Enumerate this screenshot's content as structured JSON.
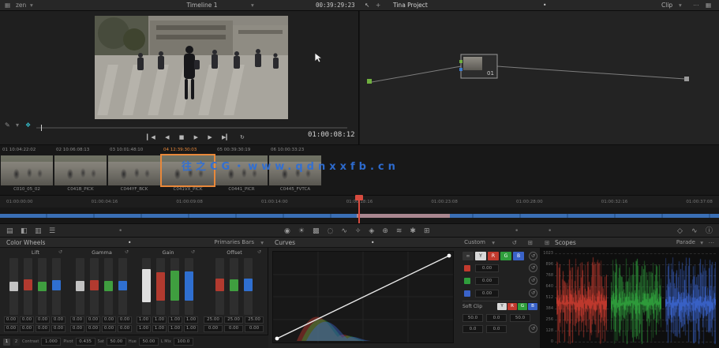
{
  "colors": {
    "accent_orange": "#e8883a",
    "playhead_red": "#d84b3f",
    "timeline_blue": "#3a6fb5",
    "watermark_blue": "#2e6fd6",
    "channel_red": "#c23a2e",
    "channel_green": "#2f9e3c",
    "channel_blue": "#3a63c9"
  },
  "topbar": {
    "left_menu": "zen",
    "timeline_selector": "Timeline 1",
    "timeline_timecode": "00:39:29:23",
    "window_title": "Tina Project",
    "clip_selector": "Clip"
  },
  "viewer": {
    "timecode": "01:00:08:12"
  },
  "node_graph": {
    "node_label": "01"
  },
  "clips": {
    "headers": [
      "01  10:04:22:02",
      "02  10:06:08:13",
      "03  10:01:48:10",
      "04  12:39:30:03",
      "05  00:39:30:19",
      "06  10:00:33:23"
    ],
    "names": [
      "C010_05_02",
      "C041B_PICK",
      "C044YF_BCK",
      "C041VX_PICK",
      "C0441_PICR",
      "C0445_FVTCA"
    ],
    "watermark": "往之CG・www.qdnxxfb.cn"
  },
  "timeline": {
    "ruler": [
      "01:00:00:00",
      "01:00:04:16",
      "01:00:09:08",
      "01:00:14:00",
      "01:00:18:16",
      "01:00:23:08",
      "01:00:28:00",
      "01:00:32:16",
      "01:00:37:08"
    ]
  },
  "wheels": {
    "title": "Color Wheels",
    "mode": "Primaries Bars",
    "columns": [
      {
        "name": "Lift",
        "row1": [
          "0.00",
          "0.00",
          "0.00",
          "0.00"
        ],
        "row2": [
          "0.00",
          "0.00",
          "0.00",
          "0.00"
        ]
      },
      {
        "name": "Gamma",
        "row1": [
          "0.00",
          "0.00",
          "0.00",
          "0.00"
        ],
        "row2": [
          "0.00",
          "0.00",
          "0.00",
          "0.00"
        ]
      },
      {
        "name": "Gain",
        "row1": [
          "1.00",
          "1.00",
          "1.00",
          "1.00"
        ],
        "row2": [
          "1.00",
          "1.00",
          "1.00",
          "1.00"
        ]
      },
      {
        "name": "Offset",
        "row1": [
          "25.00",
          "25.00",
          "25.00"
        ],
        "row2": [
          "0.00",
          "0.00",
          "0.00"
        ]
      }
    ],
    "pages": [
      "1",
      "2"
    ],
    "params": [
      {
        "label": "Contrast",
        "value": "1.000"
      },
      {
        "label": "Pivot",
        "value": "0.435"
      },
      {
        "label": "Sat",
        "value": "50.00"
      },
      {
        "label": "Hue",
        "value": "50.00"
      },
      {
        "label": "L Mix",
        "value": "100.0"
      }
    ]
  },
  "curves": {
    "title": "Curves",
    "mode": "Custom",
    "channels": [
      "Y",
      "R",
      "G",
      "B"
    ],
    "rows": [
      {
        "value": "0.00"
      },
      {
        "value": "0.00"
      },
      {
        "value": "0.00"
      }
    ],
    "soft_clip_label": "Soft Clip",
    "soft_row1": [
      "50.0",
      "0.0",
      "50.0"
    ],
    "soft_row2": [
      "0.0",
      "0.0"
    ]
  },
  "scopes": {
    "title": "Scopes",
    "mode": "Parade",
    "scale": [
      "1023",
      "896",
      "768",
      "640",
      "512",
      "384",
      "256",
      "128",
      "0"
    ]
  },
  "icons": {
    "grid": "▦",
    "caret": "▾",
    "dot": "•",
    "ellipsis": "⋯",
    "pointer": "↖",
    "move": "+",
    "gallery": "▤",
    "lut": "◧",
    "media_pool": "▥",
    "edit_index": "☰",
    "pencil": "✎",
    "fx": "❖",
    "jump_start": "▎◀",
    "step_back": "◀",
    "stop": "■",
    "play": "▶",
    "step_fwd": "▶",
    "jump_end": "▶▎",
    "loop": "↻",
    "reset": "↺",
    "link": "∞",
    "expand": "⊞",
    "wheels_tool": "◉",
    "hdr_tool": "☀",
    "mixer_tool": "▩",
    "motion_tool": "◌",
    "curves_tool": "∿",
    "qualifier_tool": "✧",
    "window_tool": "◈",
    "tracker_tool": "⊕",
    "blur_tool": "≋",
    "key_tool": "✱",
    "sizing_tool": "⊞",
    "keyframes": "◇",
    "scopes_view": "∿",
    "info": "ⓘ"
  }
}
